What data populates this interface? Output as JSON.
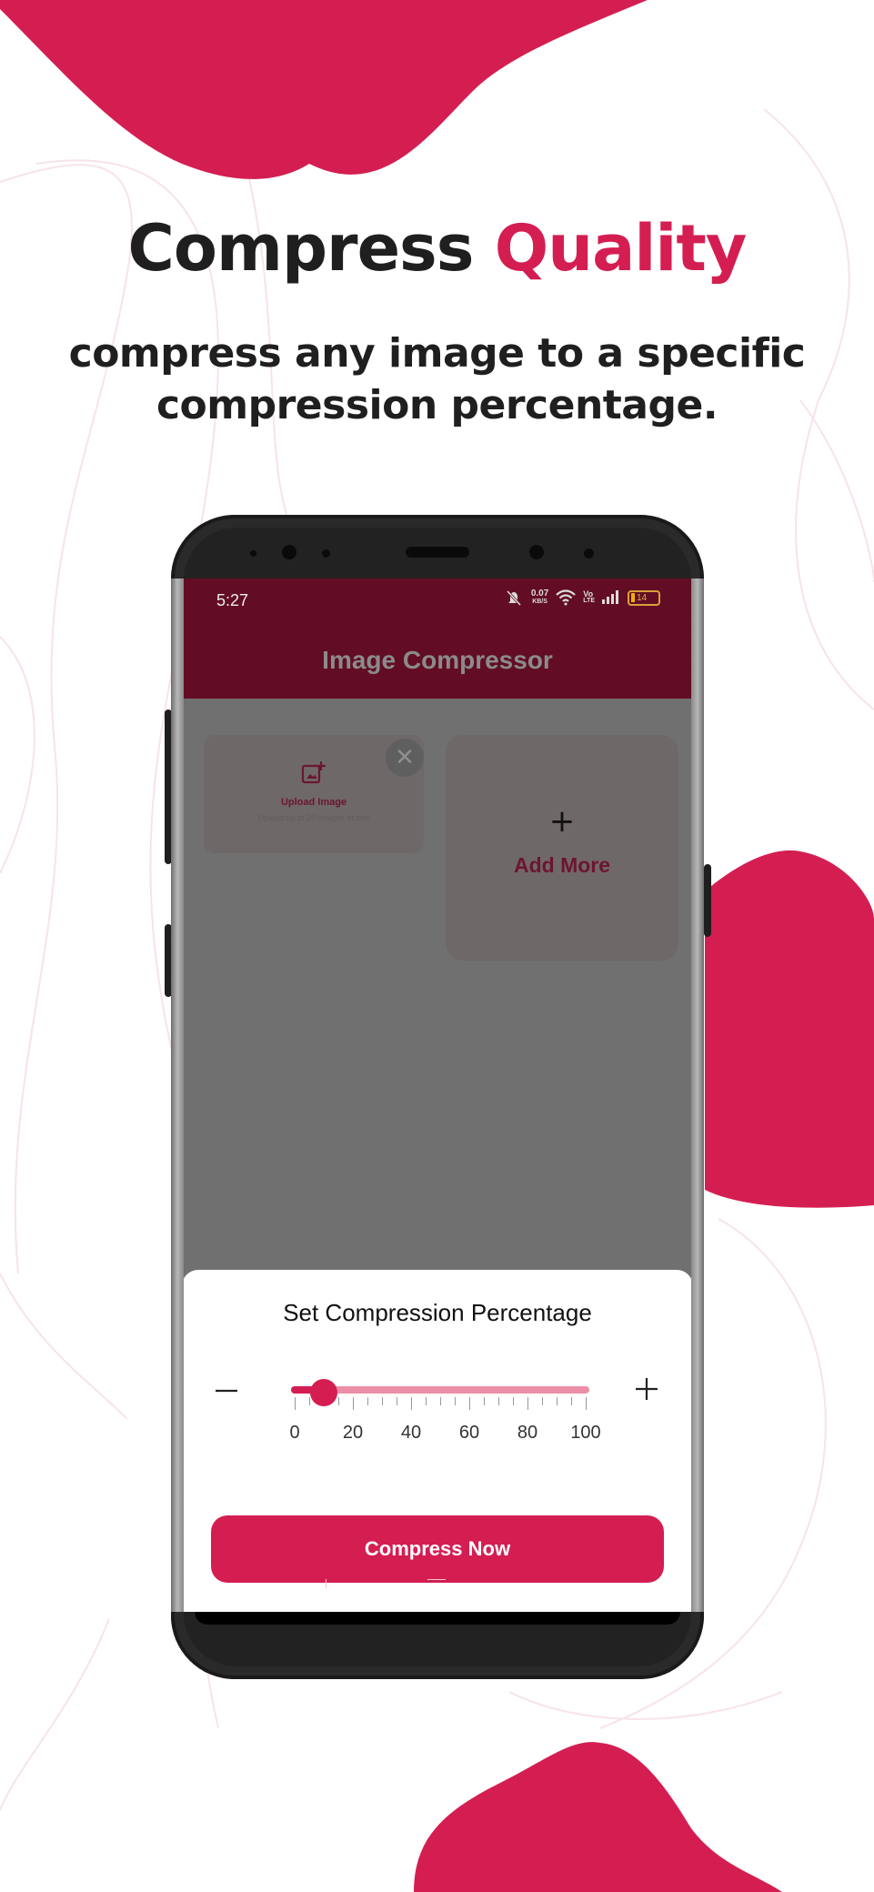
{
  "colors": {
    "accent": "#d41e52",
    "appbar": "#620d24",
    "overlay": "#707070",
    "text_dark": "#1f1f1f"
  },
  "promo": {
    "headline_part1": "Compress",
    "headline_part2": "Quality",
    "subheadline": "compress any image to a specific compression percentage."
  },
  "status_bar": {
    "time": "5:27",
    "icons": [
      "mute-icon",
      "wifi-icon",
      "volte-icon",
      "signal-icon",
      "battery-icon"
    ],
    "net_speed_value": "0.07",
    "net_speed_unit": "KB/S",
    "volte_top": "Vo",
    "volte_bottom": "LTE",
    "battery_level": "14"
  },
  "app": {
    "title": "Image Compressor",
    "upload_card": {
      "label": "Upload Image",
      "sublabel": "Upload up to 20 images at one",
      "icon": "add-photo-icon",
      "close_icon": "close-icon"
    },
    "add_more_card": {
      "icon": "plus-icon",
      "label": "Add More"
    }
  },
  "sheet": {
    "title": "Set Compression Percentage",
    "decrement_icon": "minus-icon",
    "increment_icon": "plus-icon",
    "slider": {
      "min": 0,
      "max": 100,
      "value": 10,
      "labels": [
        "0",
        "20",
        "40",
        "60",
        "80",
        "100"
      ],
      "tick_step": 5
    },
    "button_label": "Compress Now"
  }
}
